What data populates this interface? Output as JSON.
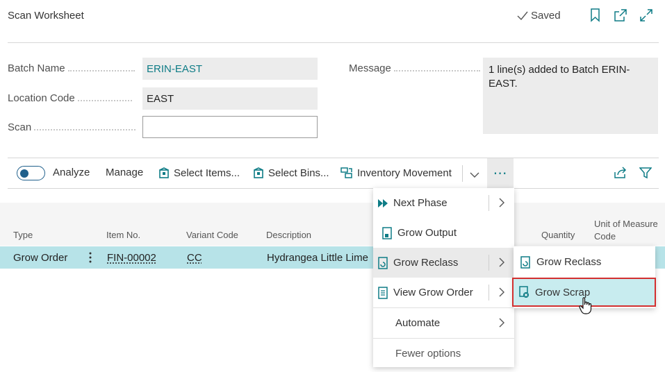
{
  "header": {
    "title": "Scan Worksheet",
    "saved_label": "Saved"
  },
  "fields": {
    "batch_name": {
      "label": "Batch Name",
      "value": "ERIN-EAST"
    },
    "location_code": {
      "label": "Location Code",
      "value": "EAST"
    },
    "scan": {
      "label": "Scan",
      "value": ""
    },
    "message": {
      "label": "Message",
      "value": "1 line(s) added to Batch ERIN-EAST."
    }
  },
  "actions": {
    "analyze": "Analyze",
    "manage": "Manage",
    "select_items": "Select Items...",
    "select_bins": "Select Bins...",
    "inventory_movement": "Inventory Movement",
    "more": "⋯"
  },
  "grid": {
    "columns": {
      "type": "Type",
      "item_no": "Item No.",
      "variant_code": "Variant Code",
      "description": "Description",
      "quantity": "Quantity",
      "uom": "Unit of Measure Code"
    },
    "rows": [
      {
        "type": "Grow Order",
        "item_no": "FIN-00002",
        "variant_code": "CC",
        "description": "Hydrangea Little Lime"
      }
    ]
  },
  "menu": {
    "items": [
      {
        "label": "Next Phase"
      },
      {
        "label": "Grow Output"
      },
      {
        "label": "Grow Reclass"
      },
      {
        "label": "View Grow Order"
      },
      {
        "label": "Automate"
      },
      {
        "label": "Fewer options"
      }
    ]
  },
  "submenu": {
    "items": [
      {
        "label": "Grow Reclass"
      },
      {
        "label": "Grow Scrap"
      }
    ]
  },
  "colors": {
    "accent": "#0e7c86",
    "selected_row": "#b7e3e8",
    "highlight_border": "#d32f2f"
  }
}
